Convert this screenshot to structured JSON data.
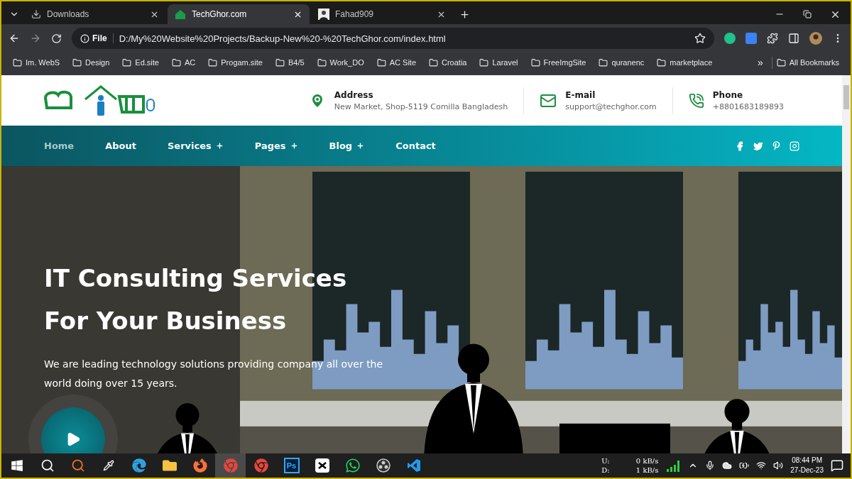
{
  "browser": {
    "tabs": [
      {
        "title": "Downloads",
        "selected": false
      },
      {
        "title": "TechGhor.com",
        "selected": true
      },
      {
        "title": "Fahad909",
        "selected": false
      }
    ],
    "address": {
      "badge": "File",
      "url": "D:/My%20Website%20Projects/Backup-New%20-%20TechGhor.com/index.html"
    },
    "bookmarks": [
      "Im. WebS",
      "Design",
      "Ed.site",
      "AC",
      "Progam.site",
      "B4/5",
      "Work_DO",
      "AC Site",
      "Croatia",
      "Laravel",
      "FreeImgSite",
      "quranenc",
      "marketplace"
    ],
    "overflow": "»",
    "all_bookmarks": "All Bookmarks"
  },
  "site": {
    "contacts": [
      {
        "kind": "address",
        "label": "Address",
        "value": "New Market, Shop-5119 Comilla Bangladesh"
      },
      {
        "kind": "email",
        "label": "E-mail",
        "value": "support@techghor.com"
      },
      {
        "kind": "phone",
        "label": "Phone",
        "value": "+8801683189893"
      }
    ],
    "nav": [
      {
        "label": "Home",
        "selected": true,
        "has_submenu": false
      },
      {
        "label": "About",
        "selected": false,
        "has_submenu": false
      },
      {
        "label": "Services",
        "selected": false,
        "has_submenu": true
      },
      {
        "label": "Pages",
        "selected": false,
        "has_submenu": true
      },
      {
        "label": "Blog",
        "selected": false,
        "has_submenu": true
      },
      {
        "label": "Contact",
        "selected": false,
        "has_submenu": false
      }
    ],
    "hero": {
      "title_lines": [
        "IT Consulting Services",
        "For Your Business"
      ],
      "subtitle": "We are leading technology solutions providing company all over the world doing over 15 years.",
      "picture": {
        "kind": "picture"
      }
    }
  },
  "taskbar": {
    "apps": [
      {
        "kind": "start",
        "selected": false
      },
      {
        "kind": "search",
        "selected": false
      },
      {
        "kind": "magnifier",
        "selected": false
      },
      {
        "kind": "picker",
        "selected": false
      },
      {
        "kind": "edge",
        "selected": false
      },
      {
        "kind": "explorer",
        "selected": false
      },
      {
        "kind": "firefox",
        "selected": false
      },
      {
        "kind": "chrome",
        "selected": true
      },
      {
        "kind": "chrome",
        "selected": false
      },
      {
        "kind": "photoshop",
        "label": "Ps",
        "selected": false
      },
      {
        "kind": "capcut",
        "selected": false
      },
      {
        "kind": "whatsapp",
        "selected": false
      },
      {
        "kind": "obs",
        "selected": false
      },
      {
        "kind": "vscode",
        "selected": false
      }
    ],
    "net": {
      "up_label": "U:",
      "up": "0 kB/s",
      "down_label": "D:",
      "down": "1 kB/s"
    },
    "time": "08:44 PM",
    "date": "27-Dec-23"
  }
}
